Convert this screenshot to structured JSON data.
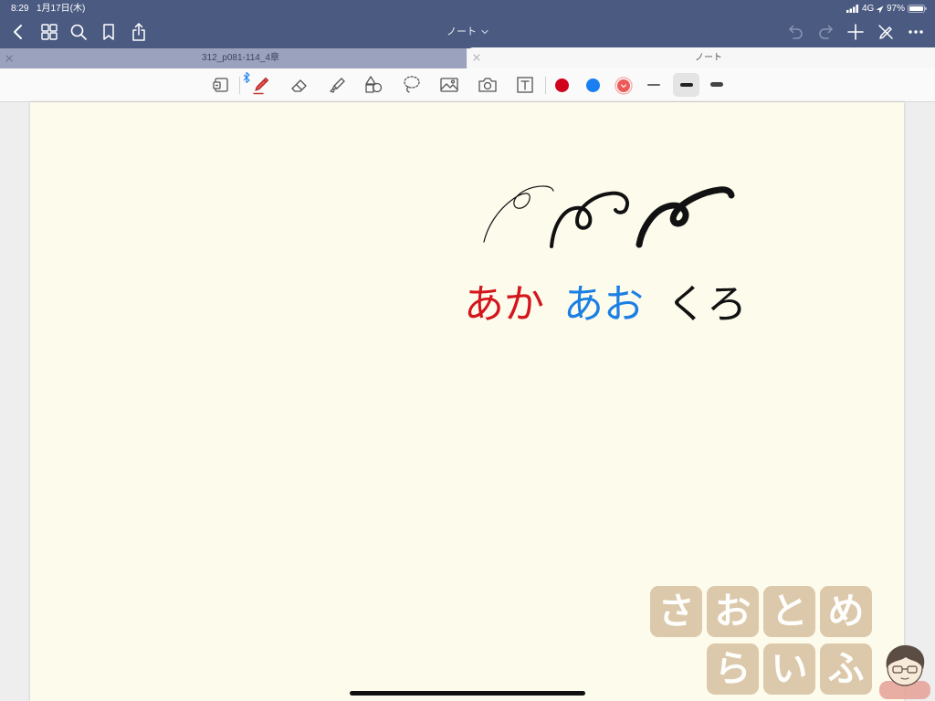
{
  "status_bar": {
    "time": "8:29",
    "date": "1月17日(木)",
    "network": "4G",
    "battery": "97%",
    "battery_level": 0.97
  },
  "nav_bar": {
    "title": "ノート",
    "background": "#4b5a81",
    "left_icons": [
      "back-chevron-icon",
      "thumbnails-grid-icon",
      "search-icon",
      "bookmark-icon",
      "share-icon"
    ],
    "right_icons": [
      "undo-icon",
      "redo-icon",
      "add-icon",
      "pen-off-icon",
      "more-icon"
    ]
  },
  "tabs": [
    {
      "label": "312_p081-114_4章",
      "active": false
    },
    {
      "label": "ノート",
      "active": true
    }
  ],
  "toolbar": {
    "tools": [
      "read-mode-icon",
      "pen-icon",
      "eraser-icon",
      "highlighter-icon",
      "shapes-icon",
      "lasso-icon",
      "image-icon",
      "camera-icon",
      "text-box-icon"
    ],
    "selected_tool": "pen-icon",
    "bluetooth_connected": true,
    "colors": [
      "#d0021b",
      "#1a7ff0",
      "#ec5a57"
    ],
    "selected_color": "#ec5a57",
    "stroke_widths": [
      "thin",
      "medium",
      "thick"
    ],
    "selected_width": "medium"
  },
  "page": {
    "background": "#fdfbec",
    "handwriting": [
      {
        "text": "あか",
        "color": "#d4161d"
      },
      {
        "text": "あお",
        "color": "#1b7fe4"
      },
      {
        "text": "くろ",
        "color": "#111111"
      }
    ]
  },
  "watermark": {
    "row1": [
      "さ",
      "お",
      "と",
      "め"
    ],
    "row2": [
      "ら",
      "い",
      "ふ"
    ],
    "color": "#d8c1a2"
  }
}
